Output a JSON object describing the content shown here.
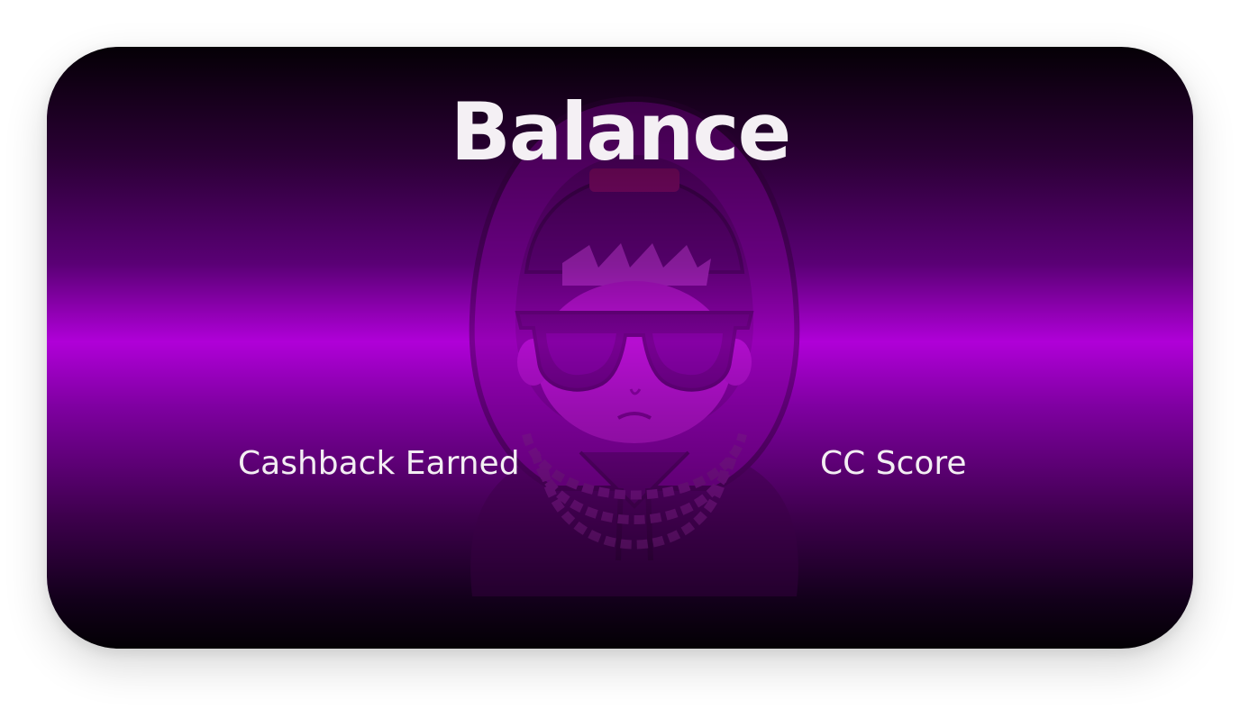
{
  "balance_card": {
    "title": "Balance",
    "stats": [
      {
        "label": "Cashback Earned"
      },
      {
        "label": "CC Score"
      }
    ],
    "avatar_icon": "hooded-character-with-sunglasses",
    "colors": {
      "accent": "#b000d8",
      "dark": "#050006",
      "text": "#f4f0f4"
    }
  }
}
